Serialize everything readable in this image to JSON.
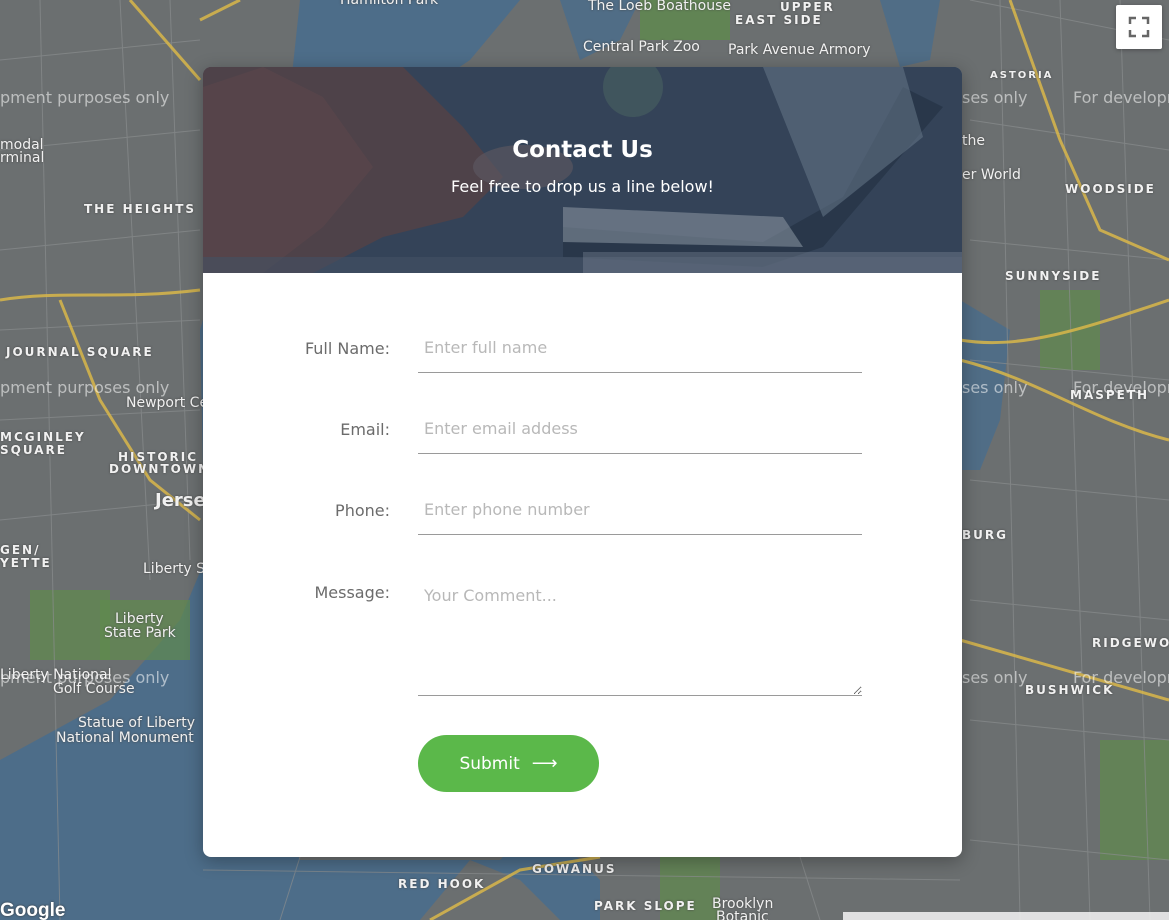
{
  "map": {
    "labels": [
      {
        "text": "Hamilton Park"
      },
      {
        "text": "The Loeb Boathouse"
      },
      {
        "text": "UPPER"
      },
      {
        "text": "EAST SIDE"
      },
      {
        "text": "Central Park Zoo"
      },
      {
        "text": "Park Avenue Armory"
      },
      {
        "text": "THE HEIGHTS"
      },
      {
        "text": "JOURNAL SQUARE"
      },
      {
        "text": "MCGINLEY"
      },
      {
        "text": "SQUARE"
      },
      {
        "text": "HISTORIC"
      },
      {
        "text": "DOWNTOWN"
      },
      {
        "text": "Jerse"
      },
      {
        "text": "Newport Ce"
      },
      {
        "text": "GEN/"
      },
      {
        "text": "YETTE"
      },
      {
        "text": "Liberty Sc"
      },
      {
        "text": "Liberty"
      },
      {
        "text": "State Park"
      },
      {
        "text": "Liberty National"
      },
      {
        "text": "Golf Course"
      },
      {
        "text": "Statue of Liberty"
      },
      {
        "text": "National Monument"
      },
      {
        "text": "modal"
      },
      {
        "text": "rminal"
      },
      {
        "text": "WOODSIDE"
      },
      {
        "text": "SUNNYSIDE"
      },
      {
        "text": "MASPETH"
      },
      {
        "text": "BURG"
      },
      {
        "text": "RIDGEWO"
      },
      {
        "text": "BUSHWICK"
      },
      {
        "text": "ASTORIA"
      },
      {
        "text": "RED HOOK"
      },
      {
        "text": "GOWANUS"
      },
      {
        "text": "PARK SLOPE"
      },
      {
        "text": "Brooklyn"
      },
      {
        "text": "Botanic"
      },
      {
        "text": "er World"
      },
      {
        "text": "the"
      }
    ],
    "watermarks": [
      {
        "text": "pment purposes only"
      },
      {
        "text": "ses only"
      },
      {
        "text": "For developm"
      },
      {
        "text": "pment purposes only"
      },
      {
        "text": "ses only"
      },
      {
        "text": "For developm"
      },
      {
        "text": "pment purposes only"
      },
      {
        "text": "ses only"
      },
      {
        "text": "For developm"
      }
    ],
    "google_logo": "Google",
    "fullscreen_icon": "fullscreen-icon"
  },
  "hero": {
    "title": "Contact Us",
    "subtitle": "Feel free to drop us a line below!"
  },
  "form": {
    "full_name": {
      "label": "Full Name:",
      "placeholder": "Enter full name"
    },
    "email": {
      "label": "Email:",
      "placeholder": "Enter email addess"
    },
    "phone": {
      "label": "Phone:",
      "placeholder": "Enter phone number"
    },
    "message": {
      "label": "Message:",
      "placeholder": "Your Comment..."
    },
    "submit": {
      "label": "Submit",
      "icon": "arrow-right-icon"
    }
  },
  "colors": {
    "accent": "#5bb84a",
    "map_background": "#6b6f70",
    "hero_overlay": "#3d4a5a"
  }
}
